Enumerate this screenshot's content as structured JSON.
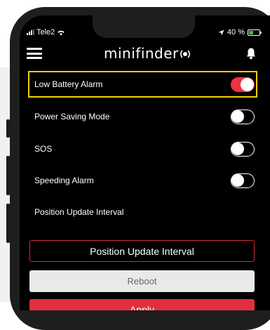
{
  "status": {
    "carrier": "Tele2",
    "battery_text": "40 %",
    "battery_level": 0.4
  },
  "header": {
    "logo_text": "minifinder"
  },
  "settings": [
    {
      "label": "Low Battery Alarm",
      "on": true
    },
    {
      "label": "Power Saving Mode",
      "on": false
    },
    {
      "label": "SOS",
      "on": false
    },
    {
      "label": "Speeding Alarm",
      "on": false
    }
  ],
  "position_update": {
    "label": "Position Update Interval",
    "button_label": "Position Update Interval"
  },
  "actions": {
    "reboot_label": "Reboot",
    "apply_label": "Apply"
  },
  "colors": {
    "accent": "#ef3340",
    "highlight": "#f5d000",
    "battery": "#2ecc40"
  },
  "icons": [
    "menu-icon",
    "wifi-icon",
    "location-arrow-icon",
    "battery-icon",
    "bell-icon",
    "logo-signal-icon"
  ]
}
